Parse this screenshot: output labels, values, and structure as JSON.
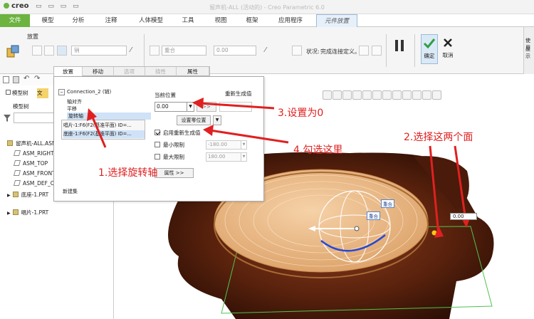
{
  "app": {
    "logo": "creo",
    "window_title": "留声机-ALL (活动的) - Creo Parametric 6.0"
  },
  "ribbon_tabs": [
    "文件",
    "模型",
    "分析",
    "注释",
    "人体模型",
    "工具",
    "视图",
    "框架",
    "应用程序",
    "元件放置"
  ],
  "ribbon": {
    "group_label": "放置",
    "connection_type": "销",
    "constraint_type": "重合",
    "offset_value": "0.00",
    "status_label": "状况:",
    "status_value": "完成连接定义。",
    "ok_label": "确定",
    "cancel_label": "取消",
    "right_text_1": "使用",
    "right_text_2": "显示"
  },
  "model_tree": {
    "tab_model": "模型树",
    "tab_other": "文",
    "header": "模型树",
    "items": [
      "留声机-ALL.ASM",
      "ASM_RIGHT",
      "ASM_TOP",
      "ASM_FRONT",
      "ASM_DEF_CSYS",
      "底座-1.PRT",
      "唱片-1.PRT"
    ]
  },
  "placement_panel": {
    "tabs": [
      "放置",
      "移动",
      "选项",
      "挠性",
      "属性"
    ],
    "connection": "Connection_2 (销)",
    "constraints": [
      "轴对齐",
      "平移",
      "旋转轴"
    ],
    "selected_constraint": "旋转轴",
    "refs": [
      "唱片-1:F6(F2(基准平面) ID=...",
      "底座-1:F6(F2(基准平面) ID=..."
    ],
    "new_set": "新建集",
    "current_position_label": "当前位置",
    "current_position_value": "0.00",
    "regen_label": "重新生成值",
    "to_regen_button": ">>",
    "set_zero_button": "设置零位置",
    "enable_regen_label": "启用重新生成值",
    "min_limit_label": "最小限制",
    "min_limit_value": "-180.00",
    "max_limit_label": "最大限制",
    "max_limit_value": "180.00",
    "properties_button": "属性 >>"
  },
  "graphics": {
    "tag_1": "重合",
    "tag_2": "重合",
    "readout": "0.00"
  },
  "annotations": {
    "a1": "1.选择旋转轴",
    "a2": "2.选择这两个面",
    "a3": "3.设置为0",
    "a4": "4.勾选这里"
  },
  "colors": {
    "file_tab": "#6cb33f",
    "annotation": "#e02020",
    "ok_check": "#2ea043"
  }
}
